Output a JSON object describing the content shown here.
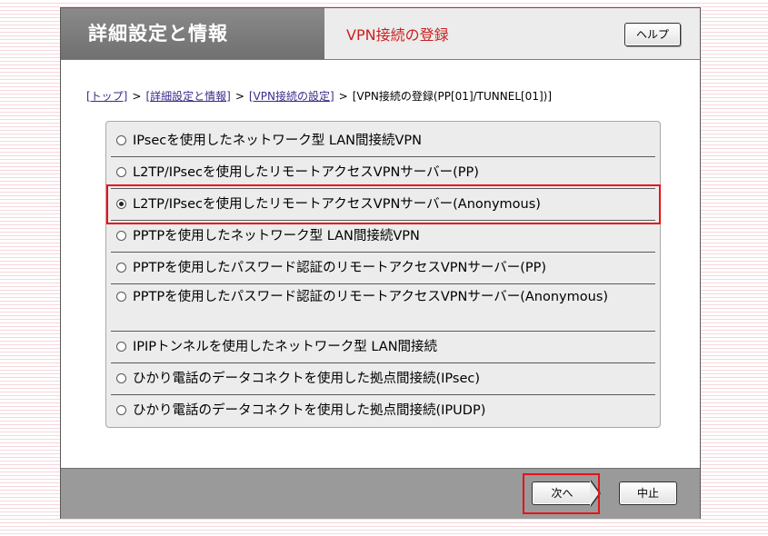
{
  "header": {
    "title": "詳細設定と情報",
    "subtitle": "VPN接続の登録",
    "help_label": "ヘルプ"
  },
  "breadcrumb": {
    "items": [
      "[トップ]",
      "[詳細設定と情報]",
      "[VPN接続の設定]"
    ],
    "separator": ">",
    "current": "[VPN接続の登録(PP[01]/TUNNEL[01])]"
  },
  "options": [
    {
      "label": "IPsecを使用したネットワーク型 LAN間接続VPN",
      "selected": false
    },
    {
      "label": "L2TP/IPsecを使用したリモートアクセスVPNサーバー(PP)",
      "selected": false
    },
    {
      "label": "L2TP/IPsecを使用したリモートアクセスVPNサーバー(Anonymous)",
      "selected": true
    },
    {
      "label": "PPTPを使用したネットワーク型 LAN間接続VPN",
      "selected": false
    },
    {
      "label": "PPTPを使用したパスワード認証のリモートアクセスVPNサーバー(PP)",
      "selected": false
    },
    {
      "label": "PPTPを使用したパスワード認証のリモートアクセスVPNサーバー(Anonymous)",
      "selected": false
    },
    {
      "label": "IPIPトンネルを使用したネットワーク型 LAN間接続",
      "selected": false
    },
    {
      "label": "ひかり電話のデータコネクトを使用した拠点間接続(IPsec)",
      "selected": false
    },
    {
      "label": "ひかり電話のデータコネクトを使用した拠点間接続(IPUDP)",
      "selected": false
    }
  ],
  "footer": {
    "next_label": "次へ",
    "cancel_label": "中止"
  },
  "colors": {
    "highlight": "#e8121b",
    "subtitle": "#cc1f1f",
    "link": "#3d2a8a"
  }
}
